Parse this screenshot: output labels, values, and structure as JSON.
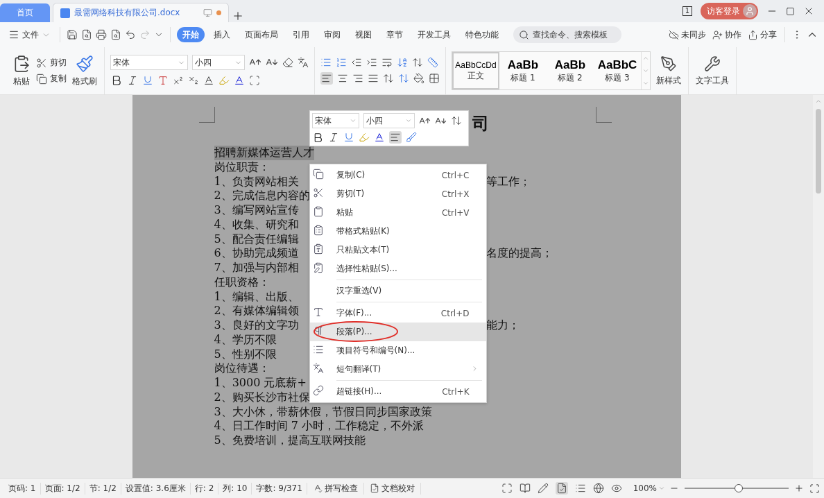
{
  "title_bar": {
    "tabs": [
      {
        "kind": "home",
        "label": "首页",
        "selected": false
      },
      {
        "kind": "document",
        "label": "最需网络科技有限公司.docx",
        "selected": true,
        "modified": true
      }
    ],
    "page_count": "1",
    "login": "访客登录"
  },
  "menu_bar": {
    "file": "文件",
    "tabs": [
      {
        "label": "开始",
        "selected": true
      },
      {
        "label": "插入",
        "selected": false
      },
      {
        "label": "页面布局",
        "selected": false
      },
      {
        "label": "引用",
        "selected": false
      },
      {
        "label": "审阅",
        "selected": false
      },
      {
        "label": "视图",
        "selected": false
      },
      {
        "label": "章节",
        "selected": false
      },
      {
        "label": "开发工具",
        "selected": false
      },
      {
        "label": "特色功能",
        "selected": false
      }
    ],
    "search": {
      "placeholder": "查找命令、搜索模板"
    },
    "actions": [
      "未同步",
      "协作",
      "分享"
    ]
  },
  "ribbon": {
    "clipboard": {
      "paste": "粘贴",
      "cut": "剪切",
      "copy": "复制",
      "format_painter": "格式刷"
    },
    "font": {
      "name": "宋体",
      "size": "小四"
    },
    "styles": [
      {
        "preview": "AaBbCcDd",
        "label": "正文",
        "selected": true
      },
      {
        "preview": "AaBb",
        "label": "标题 1",
        "selected": false
      },
      {
        "preview": "AaBb",
        "label": "标题 2",
        "selected": false
      },
      {
        "preview": "AaBbC",
        "label": "标题 3",
        "selected": false
      }
    ],
    "new_style": "新样式",
    "text_tools": "文字工具"
  },
  "document": {
    "title": "司",
    "lines": [
      {
        "text": "招聘新媒体运营人才",
        "selected": true
      },
      {
        "text": "岗位职责：",
        "selected": false
      },
      {
        "text": "1、负责网站相关",
        "right": "等工作；",
        "selected": false
      },
      {
        "text": "2、完成信息内容的",
        "selected": false
      },
      {
        "text": "3、编写网站宣传",
        "selected": false
      },
      {
        "text": "4、收集、研究和",
        "selected": false
      },
      {
        "text": "5、配合责任编辑",
        "selected": false
      },
      {
        "text": "6、协助完成频道",
        "right": "名度的提高；",
        "selected": false
      },
      {
        "text": "7、加强与内部相",
        "selected": false
      },
      {
        "text": "任职资格：",
        "selected": false
      },
      {
        "text": "1、编辑、出版、",
        "selected": false
      },
      {
        "text": "2、有媒体编辑领",
        "selected": false
      },
      {
        "text": "3、良好的文字功",
        "right": "能力；",
        "selected": false
      },
      {
        "text": "4、学历不限",
        "selected": false
      },
      {
        "text": "5、性别不限",
        "selected": false
      },
      {
        "text": "岗位待遇：",
        "selected": false
      },
      {
        "text": "1、3000 元底薪+",
        "selected": false
      },
      {
        "text": "2、购买长沙市社保",
        "selected": false
      },
      {
        "text": "3、大小休，带薪休假，节假日同步国家政策",
        "selected": false
      },
      {
        "text": "4、日工作时间 7 小时，工作稳定，不外派",
        "selected": false
      },
      {
        "text": "5、免费培训，提高互联网技能",
        "selected": false
      }
    ]
  },
  "mini_toolbar": {
    "font": "宋体",
    "size": "小四"
  },
  "context_menu": {
    "items": [
      {
        "kind": "item",
        "label": "复制(C)",
        "shortcut": "Ctrl+C",
        "selected": false
      },
      {
        "kind": "item",
        "label": "剪切(T)",
        "shortcut": "Ctrl+X",
        "selected": false
      },
      {
        "kind": "item",
        "label": "粘贴",
        "shortcut": "Ctrl+V",
        "selected": false
      },
      {
        "kind": "item",
        "label": "带格式粘贴(K)",
        "selected": false
      },
      {
        "kind": "item",
        "label": "只粘贴文本(T)",
        "selected": false
      },
      {
        "kind": "item",
        "label": "选择性粘贴(S)...",
        "selected": false
      },
      {
        "kind": "separator"
      },
      {
        "kind": "item",
        "label": "汉字重选(V)",
        "selected": false
      },
      {
        "kind": "separator"
      },
      {
        "kind": "item",
        "label": "字体(F)...",
        "shortcut": "Ctrl+D",
        "selected": false
      },
      {
        "kind": "item",
        "label": "段落(P)...",
        "selected": true
      },
      {
        "kind": "item",
        "label": "项目符号和编号(N)...",
        "selected": false
      },
      {
        "kind": "submenu",
        "label": "短句翻译(T)",
        "selected": false
      },
      {
        "kind": "separator"
      },
      {
        "kind": "item",
        "label": "超链接(H)...",
        "shortcut": "Ctrl+K",
        "selected": false
      }
    ]
  },
  "status_bar": {
    "fields": [
      "页码: 1",
      "页面: 1/2",
      "节: 1/2",
      "设置值: 3.6厘米",
      "行: 2",
      "列: 10",
      "字数: 9/371"
    ],
    "tools": [
      "拼写检查",
      "文档校对"
    ],
    "zoom": "100%",
    "zoom_slider": {
      "level": 0.52
    }
  }
}
